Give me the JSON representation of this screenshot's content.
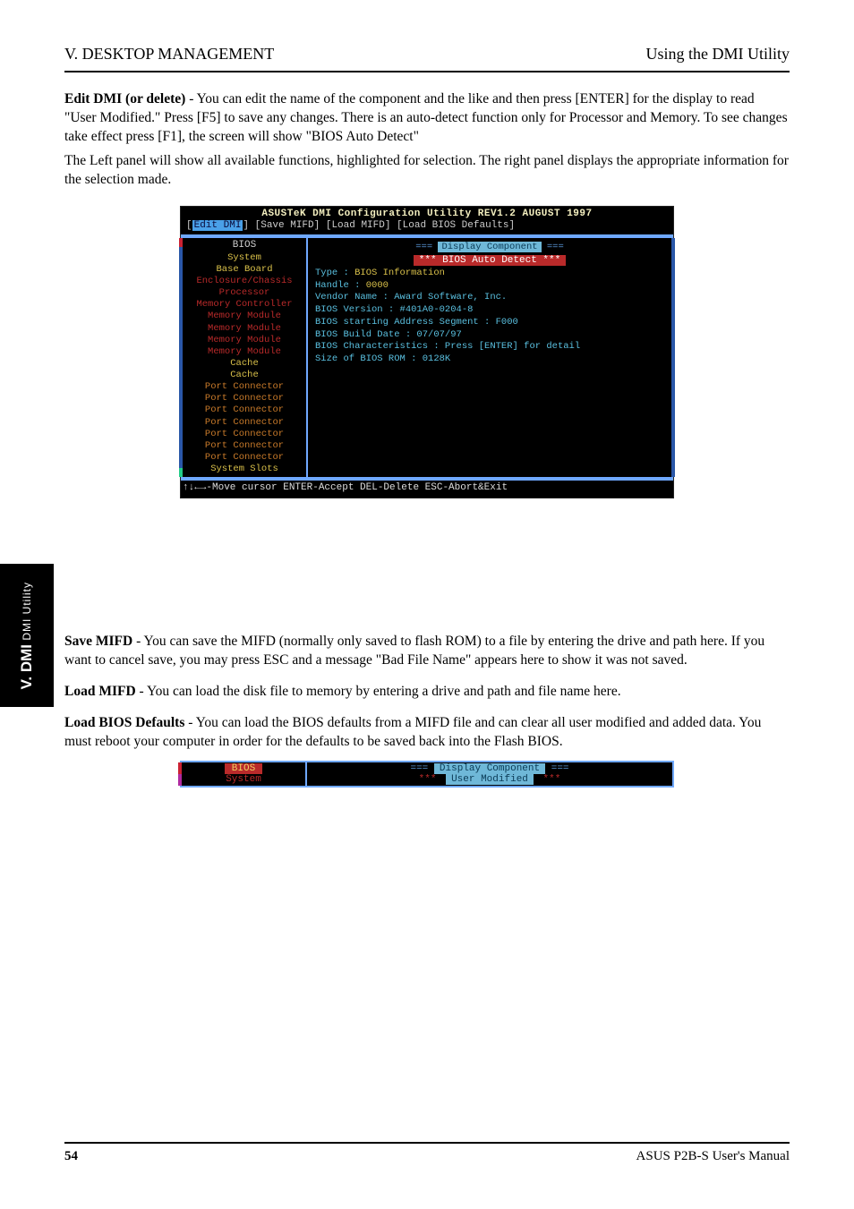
{
  "header": {
    "left": "V. DESKTOP MANAGEMENT",
    "right": "Using the DMI Utility"
  },
  "intro_p1_lead": "Edit DMI (or delete)",
  "intro_p1_rest": " - You can edit the name of the component and the like and then press [ENTER] for the display to read \"User Modified.\" Press [F5] to save any changes. There is an auto-detect function only for Processor and Memory. To see changes take effect press [F1], the screen will show \"BIOS Auto Detect\"",
  "intro_p2": "The Left panel will show all available functions, highlighted for selection. The right panel displays the appropriate information for the selection made.",
  "dos": {
    "title": "ASUSTeK DMI Configuration Utility  REV1.2   AUGUST  1997",
    "menu_prefix": "[",
    "menu_sel": "Edit DMI",
    "menu_rest": "] [Save MIFD] [Load MIFD] [Load BIOS Defaults]",
    "left_items": [
      {
        "t": "BIOS",
        "cls": "sel"
      },
      {
        "t": "System",
        "cls": "yellow"
      },
      {
        "t": "Base Board",
        "cls": "yellow"
      },
      {
        "t": "Enclosure/Chassis",
        "cls": "item"
      },
      {
        "t": "Processor",
        "cls": "item"
      },
      {
        "t": "Memory Controller",
        "cls": "item"
      },
      {
        "t": "Memory Module",
        "cls": "item"
      },
      {
        "t": "Memory Module",
        "cls": "item"
      },
      {
        "t": "Memory Module",
        "cls": "item"
      },
      {
        "t": "Memory Module",
        "cls": "item"
      },
      {
        "t": "Cache",
        "cls": "yellow"
      },
      {
        "t": "Cache",
        "cls": "yellow"
      },
      {
        "t": "Port Connector",
        "cls": "orange"
      },
      {
        "t": "Port Connector",
        "cls": "orange"
      },
      {
        "t": "Port Connector",
        "cls": "orange"
      },
      {
        "t": "Port Connector",
        "cls": "orange"
      },
      {
        "t": "Port Connector",
        "cls": "orange"
      },
      {
        "t": "Port Connector",
        "cls": "orange"
      },
      {
        "t": "Port Connector",
        "cls": "orange"
      },
      {
        "t": "System Slots",
        "cls": "yellow"
      }
    ],
    "disp_dashes": "===",
    "disp_title": "Display Component",
    "auto_detect": "***  BIOS Auto Detect  ***",
    "r_lines": [
      {
        "l": "Type : ",
        "v": "BIOS Information"
      },
      {
        "l": "Handle : ",
        "v": "0000"
      },
      {
        "l": "Vendor Name : Award Software, Inc.",
        "v": ""
      },
      {
        "l": "BIOS Version : #401A0-0204-8",
        "v": ""
      },
      {
        "l": "BIOS starting Address Segment : F000",
        "v": ""
      },
      {
        "l": "BIOS Build Date : 07/07/97",
        "v": ""
      },
      {
        "l": "BIOS Characteristics : Press [ENTER] for detail",
        "v": ""
      },
      {
        "l": "Size of BIOS ROM : 0128K",
        "v": ""
      }
    ],
    "footer": "↑↓←→-Move cursor ENTER-Accept DEL-Delete ESC-Abort&Exit"
  },
  "side": {
    "top": "DMI Utility",
    "bot": "V. DMI"
  },
  "mid": {
    "save_lead": "Save MIFD",
    "save_body": " - You can save the MIFD (normally only saved to flash ROM) to a file by entering the drive and path here. If you want to cancel save, you may press ESC and a message \"Bad File Name\" appears here to show it was not saved.",
    "load_lead": "Load MIFD",
    "load_body": " - You can load the disk file to memory by entering a drive and path and file name here.",
    "def_lead": "Load BIOS Defaults",
    "def_body": " - You can load the BIOS defaults from a MIFD file and can clear all user modified and added data. You must reboot your computer in order for the defaults to be saved back into the Flash BIOS."
  },
  "small": {
    "left1": "BIOS",
    "left2": "System",
    "disp": "Display Component",
    "um": "User Modified",
    "stars": "***"
  },
  "footer": {
    "pageno": "54",
    "product": "ASUS P2B-S User's Manual"
  }
}
